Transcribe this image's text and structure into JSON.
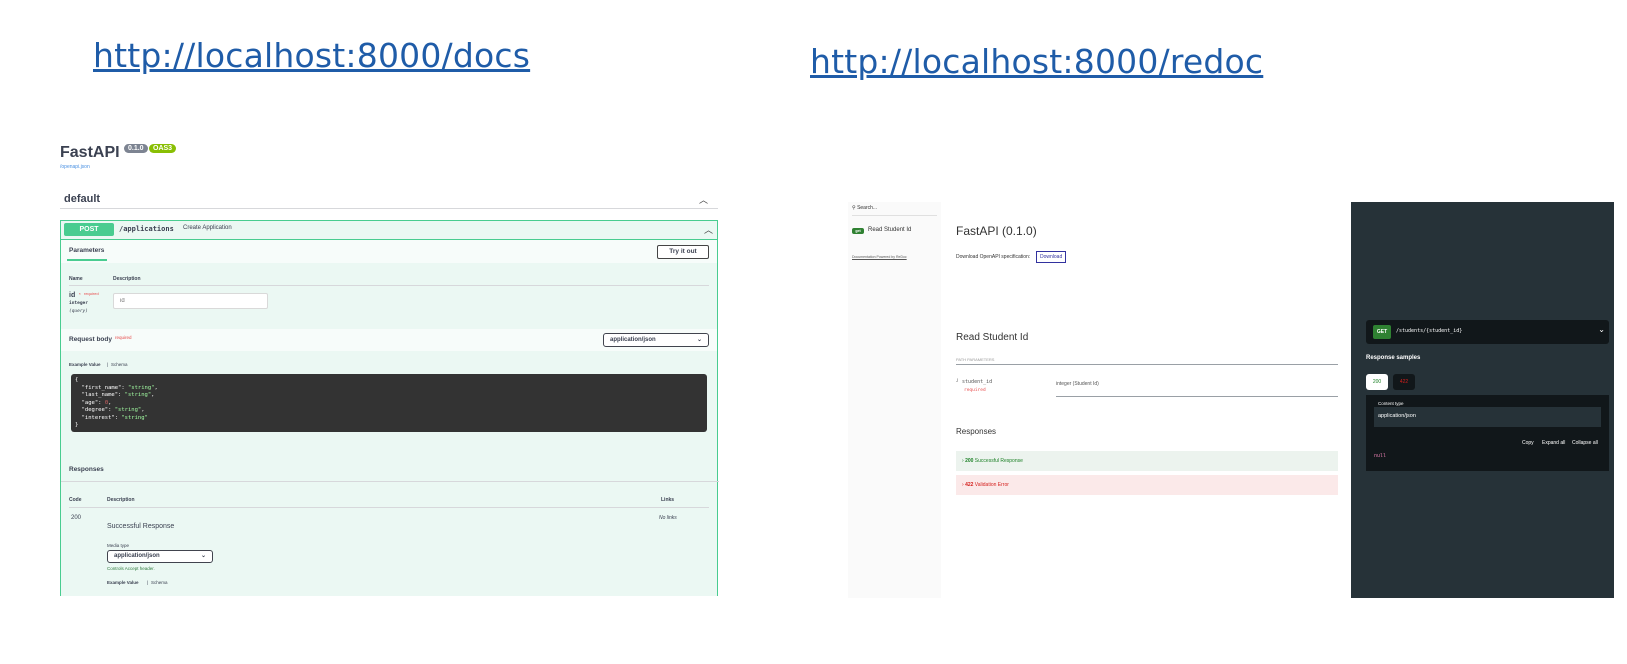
{
  "links": {
    "docs": "http://localhost:8000/docs",
    "redoc": "http://localhost:8000/redoc"
  },
  "swagger": {
    "title": "FastAPI",
    "version_badge": "0.1.0",
    "oas_badge": "OAS3",
    "openapi_link": "/openapi.json",
    "section": "default",
    "operation": {
      "method": "POST",
      "path": "/applications",
      "summary": "Create Application"
    },
    "parameters_tab": "Parameters",
    "try_button": "Try it out",
    "col_name": "Name",
    "col_description": "Description",
    "param": {
      "name": "id",
      "required_star": "*",
      "required": "required",
      "type": "integer",
      "location": "(query)",
      "placeholder": "id"
    },
    "request_body_label": "Request body",
    "request_body_required": "required",
    "content_type": "application/json",
    "example_tab": "Example Value",
    "schema_tab": "Schema",
    "example_lines": [
      {
        "key": "\"first_name\"",
        "value": "\"string\"",
        "kind": "s"
      },
      {
        "key": "\"last_name\"",
        "value": "\"string\"",
        "kind": "s"
      },
      {
        "key": "\"age\"",
        "value": "0",
        "kind": "n"
      },
      {
        "key": "\"degree\"",
        "value": "\"string\"",
        "kind": "s"
      },
      {
        "key": "\"interest\"",
        "value": "\"string\"",
        "kind": "s"
      }
    ],
    "responses_label": "Responses",
    "col_code": "Code",
    "col_links": "Links",
    "response_code": "200",
    "response_desc": "Successful Response",
    "no_links": "No links",
    "media_type_label": "Media type",
    "media_type": "application/json",
    "controls_accept": "Controls Accept header.",
    "footer_example": "Example Value",
    "footer_schema": "Schema"
  },
  "redoc": {
    "search_placeholder": "Search...",
    "menu_item_badge": "get",
    "menu_item": "Read Student Id",
    "powered_by": "Documentation Powered by ReDoc",
    "title": "FastAPI (0.1.0)",
    "download_label": "Download OpenAPI specification:",
    "download_button": "Download",
    "operation_title": "Read Student Id",
    "path_params_label": "PATH PARAMETERS",
    "param_name": "student_id",
    "param_required": "required",
    "param_type": "integer (Student Id)",
    "responses_label": "Responses",
    "resp_200": "200",
    "resp_200_text": "Successful Response",
    "resp_422": "422",
    "resp_422_text": "Validation Error",
    "right_method": "GET",
    "right_path": "/students/{student_id}",
    "response_samples": "Response samples",
    "code_200": "200",
    "code_422": "422",
    "content_type_label": "Content type",
    "content_type": "application/json",
    "copy": "Copy",
    "expand_all": "Expand all",
    "collapse_all": "Collapse all",
    "null_value": "null"
  },
  "colors": {
    "post": "#49cc90",
    "get": "#2f8132",
    "link": "#1f5ca8",
    "error": "#e84a4a"
  }
}
